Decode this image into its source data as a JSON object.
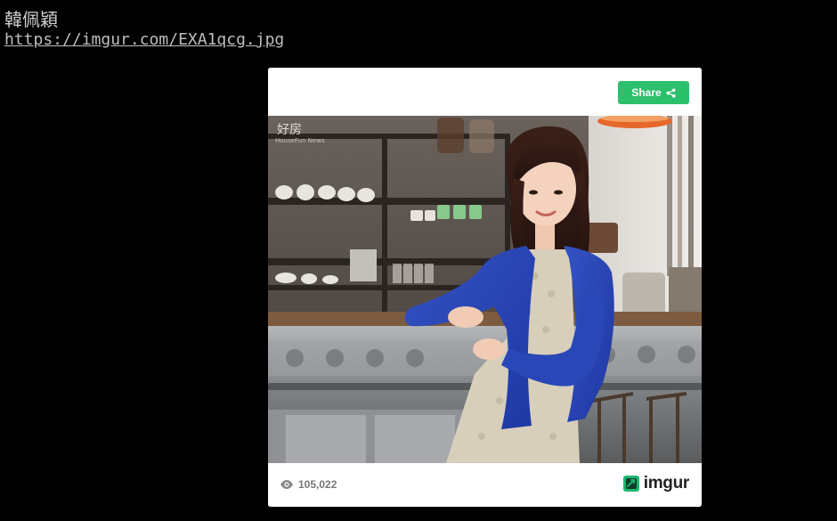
{
  "page": {
    "title": "韓佩穎",
    "link_text": "https://imgur.com/EXA1qcg.jpg"
  },
  "embed": {
    "share_label": "Share",
    "views": "105,022",
    "brand_name": "imgur",
    "photo_watermark": "好房",
    "photo_watermark_sub": "HouseFun News",
    "accent_color": "#2cc06c",
    "icons": {
      "share": "share-icon",
      "views": "eye-icon",
      "brand": "imgur-logo-icon"
    }
  }
}
